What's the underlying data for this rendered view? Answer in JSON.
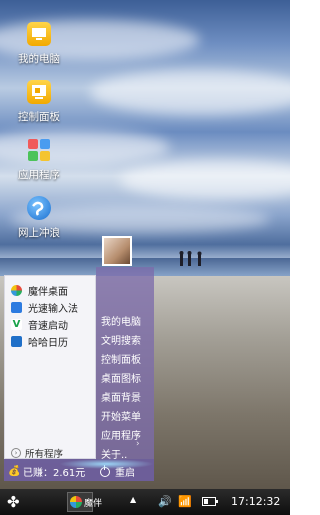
{
  "desktop": {
    "icons": [
      {
        "label": "我的电脑",
        "icon": "computer-icon"
      },
      {
        "label": "控制面板",
        "icon": "control-panel-icon"
      },
      {
        "label": "应用程序",
        "icon": "apps-grid-icon"
      },
      {
        "label": "网上冲浪",
        "icon": "browser-globe-icon"
      }
    ]
  },
  "start_menu": {
    "apps": [
      {
        "label": "魔伴桌面",
        "icon": "mojian-desktop-icon"
      },
      {
        "label": "光速输入法",
        "icon": "input-method-icon"
      },
      {
        "label": "音速启动",
        "icon": "sound-launch-icon"
      },
      {
        "label": "哈哈日历",
        "icon": "calendar-icon"
      }
    ],
    "all_programs": "所有程序",
    "system_items": [
      "我的电脑",
      "文明搜索",
      "控制面板",
      "桌面图标",
      "桌面背景",
      "开始菜单",
      "应用程序",
      "关于.."
    ],
    "earnings": "已赚：2.61元",
    "restart": "重启"
  },
  "taskbar": {
    "app_label": "魔伴",
    "time": "17:12:32",
    "tray_icons": [
      "volume-icon",
      "wifi-icon",
      "sim-icon",
      "battery-icon"
    ]
  }
}
